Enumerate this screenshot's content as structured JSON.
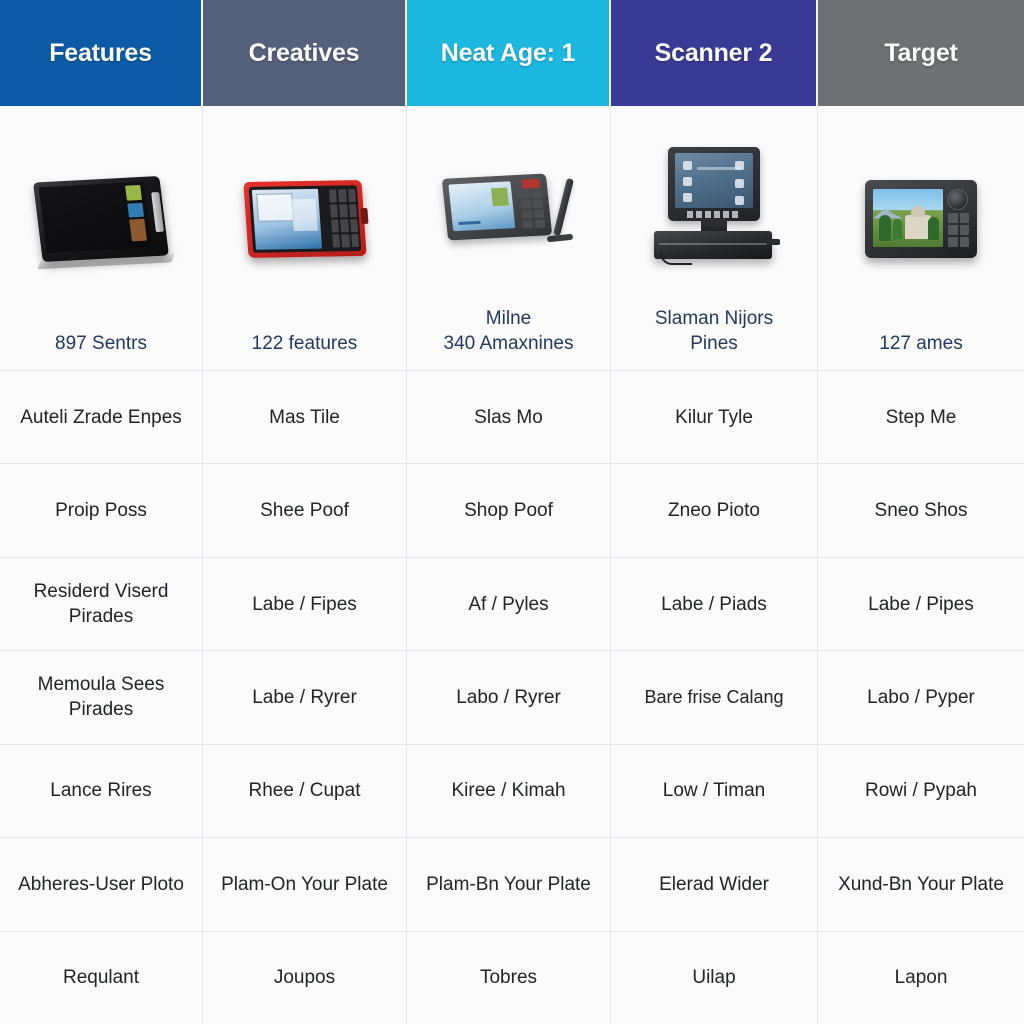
{
  "table": {
    "headers": [
      {
        "label": "Features",
        "color": "#0b5ba6"
      },
      {
        "label": "Creatives",
        "color": "#55607a"
      },
      {
        "label": "Neat Age: 1",
        "color": "#1cb8e0"
      },
      {
        "label": "Scanner 2",
        "color": "#3a3a96"
      },
      {
        "label": "Target",
        "color": "#6e7073"
      }
    ],
    "products": [
      {
        "device": "tablet-black-widescreen",
        "caption": "897 Sentrs"
      },
      {
        "device": "scanner-red-bezel",
        "caption": "122 features"
      },
      {
        "device": "scanner-grey-stand",
        "caption": "Milne\n340 Amaxnines"
      },
      {
        "device": "pos-terminal-monitor",
        "caption": "Slaman Nijors\nPines"
      },
      {
        "device": "scanner-photo-display",
        "caption": "127 ames"
      }
    ],
    "rows": [
      {
        "name": "row-1",
        "cells": [
          "Auteli Zrade Enpes",
          "Mas Tile",
          "Slas Mo",
          "Kilur Tyle",
          "Step Me"
        ]
      },
      {
        "name": "row-2",
        "cells": [
          "Proip Poss",
          "Shee Poof",
          "Shop Poof",
          "Zneo Pioto",
          "Sneo Shos"
        ]
      },
      {
        "name": "row-3",
        "cells": [
          "Residerd Viserd Pirades",
          "Labe / Fipes",
          "Af / Pyles",
          "Labe / Piads",
          "Labe / Pipes"
        ]
      },
      {
        "name": "row-4",
        "cells": [
          "Memoula Sees Pirades",
          "Labe / Ryrer",
          "Labo / Ryrer",
          "Bare frise Calang",
          "Labo / Pyper"
        ]
      },
      {
        "name": "row-5",
        "cells": [
          "Lance Rires",
          "Rhee / Cupat",
          "Kiree / Kimah",
          "Low / Timan",
          "Rowi / Pypah"
        ]
      },
      {
        "name": "row-6",
        "cells": [
          "Abheres-User Ploto",
          "Plam-On Your Plate",
          "Plam-Bn Your Plate",
          "Elerad Wider",
          "Xund-Bn Your Plate"
        ]
      },
      {
        "name": "row-7",
        "cells": [
          "Requlant",
          "Joupos",
          "Tobres",
          "Uilap",
          "Lapon"
        ]
      }
    ]
  },
  "colors": {
    "caption_text": "#233a5e",
    "body_text": "#222428",
    "cell_background": "#fbfbfc",
    "grid_line": "#e3e6ea"
  }
}
